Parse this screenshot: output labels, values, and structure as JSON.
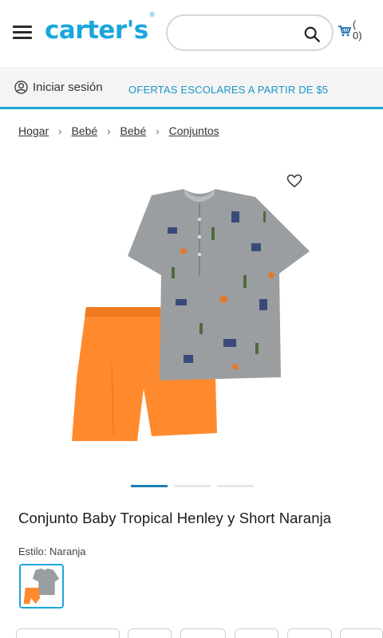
{
  "header": {
    "logo": "carter's",
    "search": {
      "placeholder": "",
      "value": ""
    },
    "cart": {
      "count_text": "(\n0)"
    }
  },
  "subbar": {
    "signin_label": "Iniciar sesión",
    "promo_text": "OFERTAS ESCOLARES A PARTIR DE $5"
  },
  "breadcrumb": {
    "items": [
      "Hogar",
      "Bebé",
      "Bebé",
      "Conjuntos"
    ]
  },
  "carousel": {
    "total_slides": 3,
    "active_index": 0
  },
  "product": {
    "title": "Conjunto Baby Tropical Henley y Short Naranja",
    "style_label": "Estilo: Naranja",
    "colors": {
      "shirt": "#9a9ea1",
      "shorts": "#ff8a2e"
    }
  },
  "colors": {
    "brand": "#1aa6dd",
    "promo": "#1a95c9",
    "active_dot": "#1a7fb3"
  }
}
